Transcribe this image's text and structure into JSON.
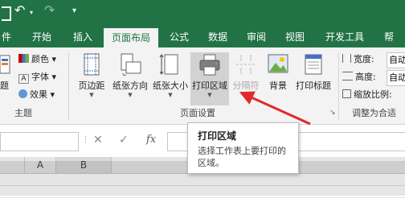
{
  "quick_access": {
    "save_icon": "save-icon",
    "undo_icon": "↶",
    "undo_dropdown": "▾",
    "redo_icon": "↷",
    "customize_icon": "▾"
  },
  "tabs": [
    {
      "label": "件"
    },
    {
      "label": "开始"
    },
    {
      "label": "插入"
    },
    {
      "label": "页面布局",
      "active": true
    },
    {
      "label": "公式"
    },
    {
      "label": "数据"
    },
    {
      "label": "审阅"
    },
    {
      "label": "视图"
    },
    {
      "label": "开发工具"
    },
    {
      "label": "帮"
    }
  ],
  "ribbon": {
    "themes_group": {
      "label": "主题",
      "theme_button_label": "题",
      "colors_label": "颜色",
      "fonts_label": "字体",
      "effects_label": "效果"
    },
    "page_setup_group": {
      "label": "页面设置",
      "margins_label": "页边距",
      "orientation_label": "纸张方向",
      "size_label": "纸张大小",
      "print_area_label": "打印区域",
      "breaks_label": "分隔符",
      "background_label": "背景",
      "print_titles_label": "打印标题"
    },
    "scale_group": {
      "label": "调整为合适",
      "width_label": "宽度:",
      "width_value": "自动",
      "height_label": "高度:",
      "height_value": "自动",
      "scale_label": "缩放比例:"
    }
  },
  "formula_bar": {
    "cancel": "✕",
    "enter": "✓",
    "fx": "fx"
  },
  "columns": [
    "A",
    "B"
  ],
  "tooltip": {
    "title": "打印区域",
    "description": "选择工作表上要打印的区域。"
  },
  "colors": {
    "accent": "#217346",
    "ribbon_bg": "#f3f3f3",
    "arrow": "#e02b2b"
  }
}
